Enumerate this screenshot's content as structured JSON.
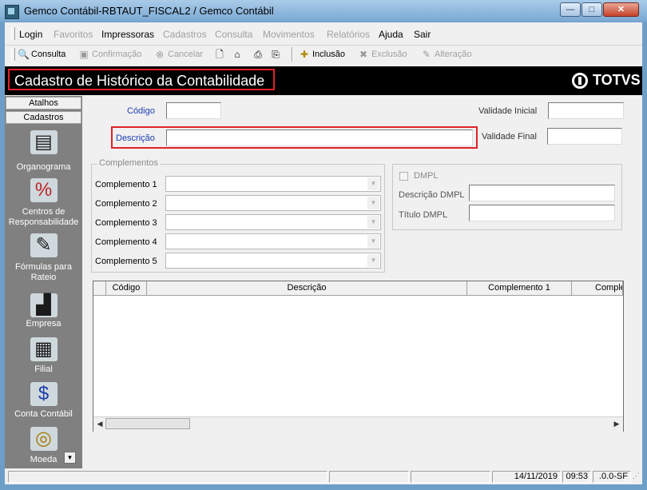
{
  "window": {
    "title": "Gemco Contábil-RBTAUT_FISCAL2 / Gemco Contábil",
    "minimize_label": "—",
    "maximize_label": "□",
    "close_label": "✕"
  },
  "menu": {
    "items": [
      {
        "label": "Login",
        "enabled": true
      },
      {
        "label": "Favoritos",
        "enabled": false
      },
      {
        "label": "Impressoras",
        "enabled": true
      },
      {
        "label": "Cadastros",
        "enabled": false
      },
      {
        "label": "Consulta",
        "enabled": false
      },
      {
        "label": "Movimentos",
        "enabled": false
      },
      {
        "label": "Relatórios",
        "enabled": false
      },
      {
        "label": "Ajuda",
        "enabled": true
      },
      {
        "label": "Sair",
        "enabled": true
      }
    ]
  },
  "toolbar": {
    "consulta": "Consulta",
    "confirmacao": "Confirmação",
    "cancelar": "Cancelar",
    "inclusao": "Inclusão",
    "exclusao": "Exclusão",
    "alteracao": "Alteração"
  },
  "header": {
    "title": "Cadastro de Histórico da Contabilidade",
    "brand": "TOTVS"
  },
  "sidebar": {
    "tabs": [
      "Atalhos",
      "Cadastros"
    ],
    "items": [
      {
        "label": "Organograma",
        "icon": "organogram-icon"
      },
      {
        "label": "Centros de Responsabilidade",
        "icon": "percent-money-icon"
      },
      {
        "label": "Fórmulas para Rateio",
        "icon": "formula-pencil-icon"
      },
      {
        "label": "Empresa",
        "icon": "factory-icon"
      },
      {
        "label": "Filial",
        "icon": "building-icon"
      },
      {
        "label": "Conta Contábil",
        "icon": "money-bag-icon"
      },
      {
        "label": "Moeda",
        "icon": "coins-icon"
      }
    ]
  },
  "form": {
    "codigo_label": "Código",
    "codigo_value": "",
    "descricao_label": "Descrição",
    "descricao_value": "",
    "validade_inicial_label": "Validade Inicial",
    "validade_inicial_value": "",
    "validade_final_label": "Validade Final",
    "validade_final_value": "",
    "complementos_title": "Complementos",
    "complementos": [
      {
        "label": "Complemento 1",
        "value": ""
      },
      {
        "label": "Complemento 2",
        "value": ""
      },
      {
        "label": "Complemento 3",
        "value": ""
      },
      {
        "label": "Complemento 4",
        "value": ""
      },
      {
        "label": "Complemento 5",
        "value": ""
      }
    ],
    "dmpl_label": "DMPL",
    "dmpl_checked": false,
    "descricao_dmpl_label": "Descrição DMPL",
    "descricao_dmpl_value": "",
    "titulo_dmpl_label": "Título DMPL",
    "titulo_dmpl_value": ""
  },
  "grid": {
    "columns": [
      "Código",
      "Descrição",
      "Complemento 1",
      "Comple"
    ],
    "rows": []
  },
  "statusbar": {
    "date": "14/11/2019",
    "time": "09:53",
    "version": ".0.0-SF"
  },
  "colors": {
    "highlight": "#e0222a",
    "header_bg": "#000000",
    "sidebar_bg": "#808080",
    "label_blue": "#1c3cb5"
  }
}
